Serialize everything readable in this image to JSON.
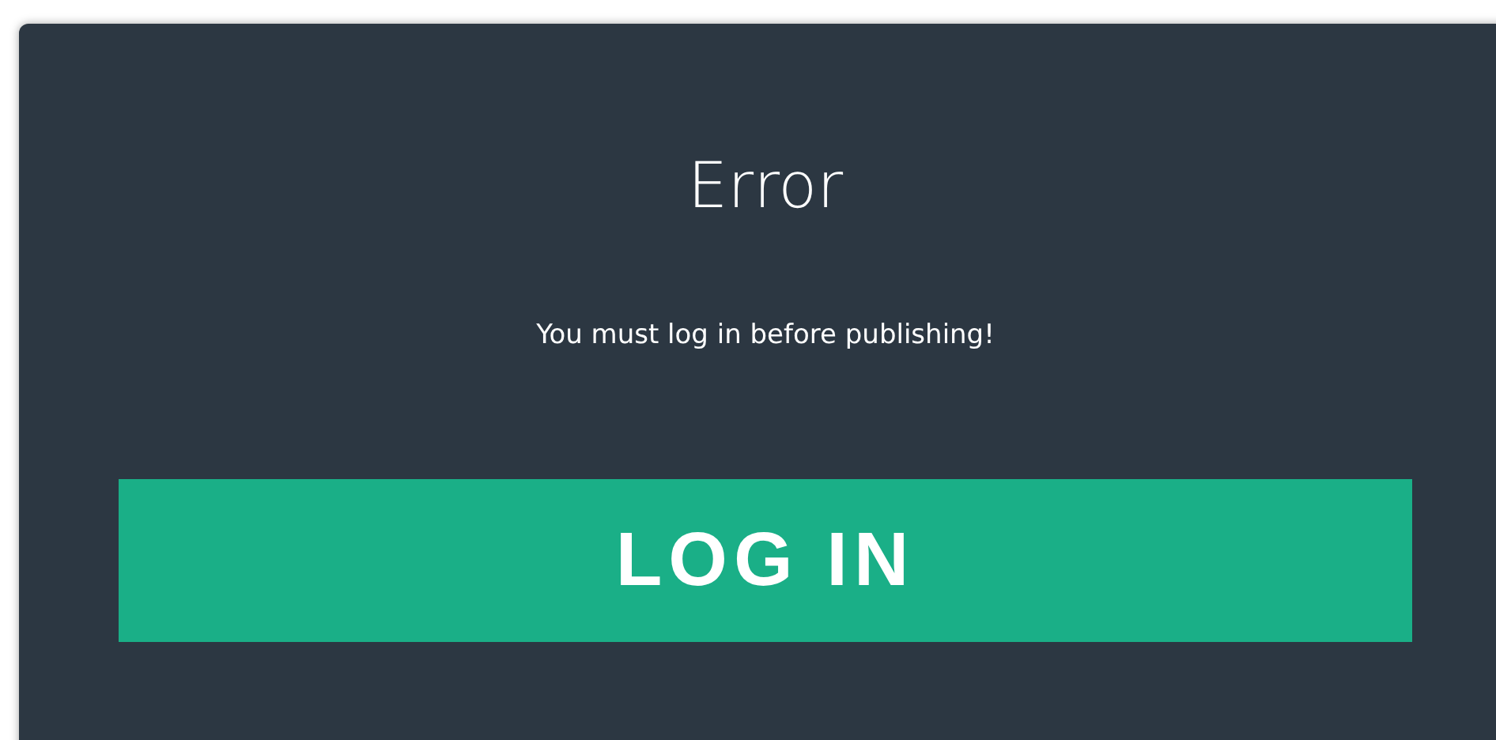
{
  "dialog": {
    "title": "Error",
    "message": "You must log in before publishing!",
    "button": "LOG IN"
  }
}
